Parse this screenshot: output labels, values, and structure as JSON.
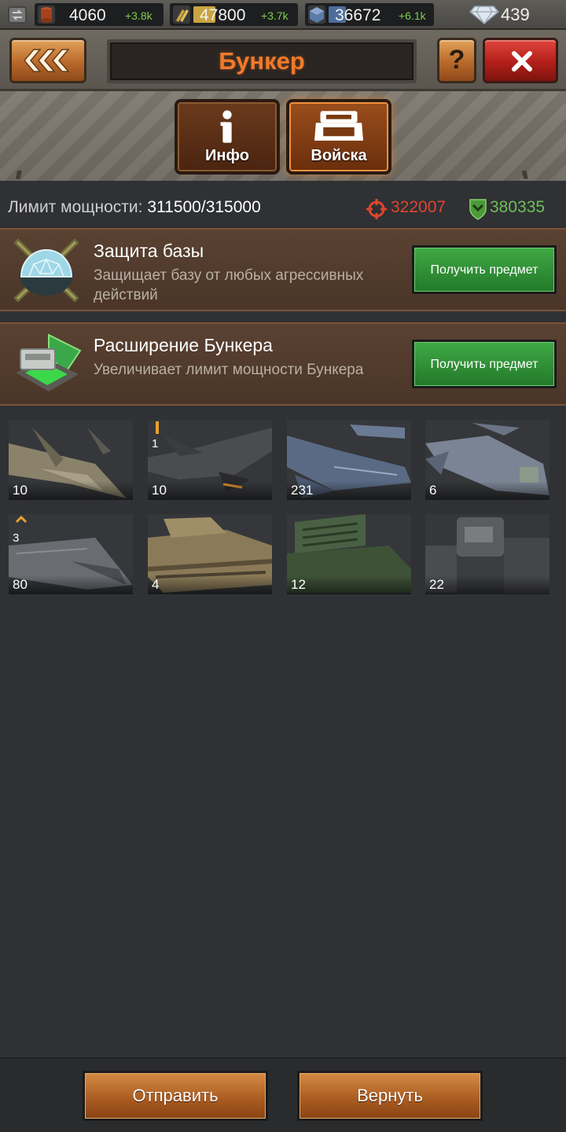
{
  "resources": {
    "food": {
      "value": "4060",
      "income": "+3.8k",
      "icon": "food-barrel-icon"
    },
    "ammo": {
      "value": "47800",
      "income": "+3.7k",
      "icon": "ammo-icon"
    },
    "metal": {
      "value": "36672",
      "income": "+6.1k",
      "icon": "metal-cube-icon"
    },
    "diamonds": {
      "value": "439",
      "icon": "diamond-icon"
    }
  },
  "header": {
    "title": "Бункер",
    "tabs": [
      {
        "label": "Инфо",
        "icon": "info-icon",
        "active": false
      },
      {
        "label": "Войска",
        "icon": "troops-bunker-icon",
        "active": true
      }
    ]
  },
  "power": {
    "label": "Лимит мощности:",
    "value": "311500/315000",
    "attack": "322007",
    "defense": "380335"
  },
  "items": [
    {
      "title": "Защита базы",
      "description": "Защищает базу от любых агрессивных действий",
      "button": "Получить предмет",
      "icon": "base-shield-icon"
    },
    {
      "title": "Расширение Бункера",
      "description": "Увеличивает лимит мощности Бункера",
      "button": "Получить предмет",
      "icon": "bunker-expansion-icon"
    }
  ],
  "troops": [
    {
      "count": "10",
      "level": "",
      "kind": "jet-fighter"
    },
    {
      "count": "10",
      "level": "1",
      "kind": "stealth-jet"
    },
    {
      "count": "231",
      "level": "",
      "kind": "vtol-aircraft"
    },
    {
      "count": "6",
      "level": "",
      "kind": "gunship"
    },
    {
      "count": "80",
      "level": "3",
      "kind": "stealth-bomber"
    },
    {
      "count": "4",
      "level": "",
      "kind": "desert-tank"
    },
    {
      "count": "12",
      "level": "",
      "kind": "missile-launcher"
    },
    {
      "count": "22",
      "level": "",
      "kind": "mech"
    }
  ],
  "footer": {
    "send": "Отправить",
    "return": "Вернуть"
  },
  "colors": {
    "title": "#f07a2a",
    "attack": "#e0452f",
    "defense": "#6fbf58",
    "income": "#7bd04c",
    "button_green": "#3fa844",
    "button_orange": "#d48a44"
  }
}
